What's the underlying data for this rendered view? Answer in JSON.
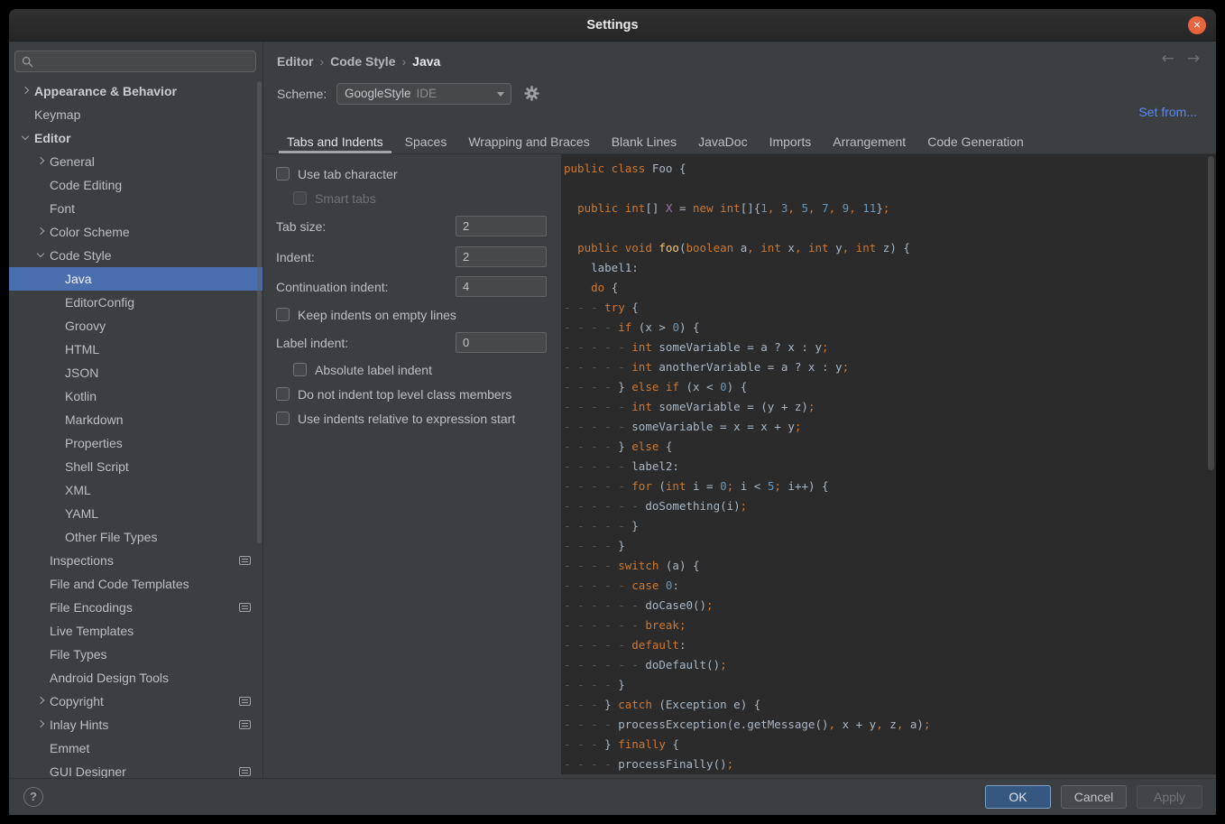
{
  "window": {
    "title": "Settings",
    "close_glyph": "×"
  },
  "sidebar": {
    "search": {
      "placeholder": ""
    },
    "items": [
      {
        "label": "Appearance & Behavior",
        "level": 0,
        "arrow": "collapsed",
        "bold": true
      },
      {
        "label": "Keymap",
        "level": 0
      },
      {
        "label": "Editor",
        "level": 0,
        "arrow": "expanded",
        "bold": true
      },
      {
        "label": "General",
        "level": 1,
        "arrow": "collapsed"
      },
      {
        "label": "Code Editing",
        "level": 1
      },
      {
        "label": "Font",
        "level": 1
      },
      {
        "label": "Color Scheme",
        "level": 1,
        "arrow": "collapsed"
      },
      {
        "label": "Code Style",
        "level": 1,
        "arrow": "expanded"
      },
      {
        "label": "Java",
        "level": 2,
        "selected": true
      },
      {
        "label": "EditorConfig",
        "level": 2
      },
      {
        "label": "Groovy",
        "level": 2
      },
      {
        "label": "HTML",
        "level": 2
      },
      {
        "label": "JSON",
        "level": 2
      },
      {
        "label": "Kotlin",
        "level": 2
      },
      {
        "label": "Markdown",
        "level": 2
      },
      {
        "label": "Properties",
        "level": 2
      },
      {
        "label": "Shell Script",
        "level": 2
      },
      {
        "label": "XML",
        "level": 2
      },
      {
        "label": "YAML",
        "level": 2
      },
      {
        "label": "Other File Types",
        "level": 2
      },
      {
        "label": "Inspections",
        "level": 1,
        "badge": true
      },
      {
        "label": "File and Code Templates",
        "level": 1
      },
      {
        "label": "File Encodings",
        "level": 1,
        "badge": true
      },
      {
        "label": "Live Templates",
        "level": 1
      },
      {
        "label": "File Types",
        "level": 1
      },
      {
        "label": "Android Design Tools",
        "level": 1
      },
      {
        "label": "Copyright",
        "level": 1,
        "arrow": "collapsed",
        "badge": true
      },
      {
        "label": "Inlay Hints",
        "level": 1,
        "arrow": "collapsed",
        "badge": true
      },
      {
        "label": "Emmet",
        "level": 1
      },
      {
        "label": "GUI Designer",
        "level": 1,
        "badge": true
      }
    ]
  },
  "header": {
    "breadcrumb": [
      "Editor",
      "Code Style",
      "Java"
    ],
    "separator": "›",
    "back_glyph": "←",
    "forward_glyph": "→",
    "scheme_label": "Scheme:",
    "scheme_value": "GoogleStyle",
    "scheme_suffix": "IDE",
    "set_from_link": "Set from..."
  },
  "tabs": {
    "selected_index": 0,
    "items": [
      "Tabs and Indents",
      "Spaces",
      "Wrapping and Braces",
      "Blank Lines",
      "JavaDoc",
      "Imports",
      "Arrangement",
      "Code Generation"
    ]
  },
  "form": {
    "use_tab_character": {
      "label": "Use tab character",
      "checked": false
    },
    "smart_tabs": {
      "label": "Smart tabs",
      "checked": false,
      "disabled": true
    },
    "tab_size": {
      "label": "Tab size:",
      "value": "2"
    },
    "indent": {
      "label": "Indent:",
      "value": "2"
    },
    "continuation_indent": {
      "label": "Continuation indent:",
      "value": "4"
    },
    "keep_indents_on_empty_lines": {
      "label": "Keep indents on empty lines",
      "checked": false
    },
    "label_indent": {
      "label": "Label indent:",
      "value": "0"
    },
    "absolute_label_indent": {
      "label": "Absolute label indent",
      "checked": false
    },
    "do_not_indent_top_level_class_members": {
      "label": "Do not indent top level class members",
      "checked": false
    },
    "use_indents_relative_to_expression_start": {
      "label": "Use indents relative to expression start",
      "checked": false
    }
  },
  "preview": {
    "lines": [
      [
        [
          "k",
          "public class "
        ],
        [
          "t",
          "Foo {"
        ]
      ],
      [],
      [
        [
          "t",
          "  "
        ],
        [
          "k",
          "public int"
        ],
        [
          "t",
          "[] "
        ],
        [
          "f",
          "X"
        ],
        [
          "t",
          " = "
        ],
        [
          "k",
          "new int"
        ],
        [
          "t",
          "[]{"
        ],
        [
          "n",
          "1"
        ],
        [
          "k",
          ", "
        ],
        [
          "n",
          "3"
        ],
        [
          "k",
          ", "
        ],
        [
          "n",
          "5"
        ],
        [
          "k",
          ", "
        ],
        [
          "n",
          "7"
        ],
        [
          "k",
          ", "
        ],
        [
          "n",
          "9"
        ],
        [
          "k",
          ", "
        ],
        [
          "n",
          "11"
        ],
        [
          "t",
          "}"
        ],
        [
          "k",
          ";"
        ]
      ],
      [],
      [
        [
          "t",
          "  "
        ],
        [
          "k",
          "public void "
        ],
        [
          "m",
          "foo"
        ],
        [
          "t",
          "("
        ],
        [
          "k",
          "boolean"
        ],
        [
          "t",
          " a"
        ],
        [
          "k",
          ", int"
        ],
        [
          "t",
          " x"
        ],
        [
          "k",
          ", int"
        ],
        [
          "t",
          " y"
        ],
        [
          "k",
          ", int"
        ],
        [
          "t",
          " z) {"
        ]
      ],
      [
        [
          "t",
          "    label1:"
        ]
      ],
      [
        [
          "t",
          "    "
        ],
        [
          "k",
          "do"
        ],
        [
          "t",
          " {"
        ]
      ],
      [
        [
          "w",
          "- - - "
        ],
        [
          "k",
          "try"
        ],
        [
          "t",
          " {"
        ]
      ],
      [
        [
          "w",
          "- - - - "
        ],
        [
          "k",
          "if"
        ],
        [
          "t",
          " (x > "
        ],
        [
          "n",
          "0"
        ],
        [
          "t",
          ") {"
        ]
      ],
      [
        [
          "w",
          "- - - - - "
        ],
        [
          "k",
          "int"
        ],
        [
          "t",
          " someVariable = a ? x : y"
        ],
        [
          "k",
          ";"
        ]
      ],
      [
        [
          "w",
          "- - - - - "
        ],
        [
          "k",
          "int"
        ],
        [
          "t",
          " anotherVariable = a ? x : y"
        ],
        [
          "k",
          ";"
        ]
      ],
      [
        [
          "w",
          "- - - - "
        ],
        [
          "t",
          "} "
        ],
        [
          "k",
          "else if"
        ],
        [
          "t",
          " (x < "
        ],
        [
          "n",
          "0"
        ],
        [
          "t",
          ") {"
        ]
      ],
      [
        [
          "w",
          "- - - - - "
        ],
        [
          "k",
          "int"
        ],
        [
          "t",
          " someVariable = (y + z)"
        ],
        [
          "k",
          ";"
        ]
      ],
      [
        [
          "w",
          "- - - - - "
        ],
        [
          "t",
          "someVariable = x = x + y"
        ],
        [
          "k",
          ";"
        ]
      ],
      [
        [
          "w",
          "- - - - "
        ],
        [
          "t",
          "} "
        ],
        [
          "k",
          "else"
        ],
        [
          "t",
          " {"
        ]
      ],
      [
        [
          "w",
          "- - - - - "
        ],
        [
          "t",
          "label2:"
        ]
      ],
      [
        [
          "w",
          "- - - - - "
        ],
        [
          "k",
          "for"
        ],
        [
          "t",
          " ("
        ],
        [
          "k",
          "int"
        ],
        [
          "t",
          " i = "
        ],
        [
          "n",
          "0"
        ],
        [
          "k",
          "; "
        ],
        [
          "t",
          "i < "
        ],
        [
          "n",
          "5"
        ],
        [
          "k",
          "; "
        ],
        [
          "t",
          "i++) {"
        ]
      ],
      [
        [
          "w",
          "- - - - - - "
        ],
        [
          "t",
          "doSomething(i)"
        ],
        [
          "k",
          ";"
        ]
      ],
      [
        [
          "w",
          "- - - - - "
        ],
        [
          "t",
          "}"
        ]
      ],
      [
        [
          "w",
          "- - - - "
        ],
        [
          "t",
          "}"
        ]
      ],
      [
        [
          "w",
          "- - - - "
        ],
        [
          "k",
          "switch"
        ],
        [
          "t",
          " (a) {"
        ]
      ],
      [
        [
          "w",
          "- - - - - "
        ],
        [
          "k",
          "case "
        ],
        [
          "n",
          "0"
        ],
        [
          "t",
          ":"
        ]
      ],
      [
        [
          "w",
          "- - - - - - "
        ],
        [
          "t",
          "doCase0()"
        ],
        [
          "k",
          ";"
        ]
      ],
      [
        [
          "w",
          "- - - - - - "
        ],
        [
          "k",
          "break;"
        ]
      ],
      [
        [
          "w",
          "- - - - - "
        ],
        [
          "k",
          "default"
        ],
        [
          "t",
          ":"
        ]
      ],
      [
        [
          "w",
          "- - - - - - "
        ],
        [
          "t",
          "doDefault()"
        ],
        [
          "k",
          ";"
        ]
      ],
      [
        [
          "w",
          "- - - - "
        ],
        [
          "t",
          "}"
        ]
      ],
      [
        [
          "w",
          "- - - "
        ],
        [
          "t",
          "} "
        ],
        [
          "k",
          "catch"
        ],
        [
          "t",
          " (Exception e) {"
        ]
      ],
      [
        [
          "w",
          "- - - - "
        ],
        [
          "t",
          "processException(e.getMessage()"
        ],
        [
          "k",
          ", "
        ],
        [
          "t",
          "x + y"
        ],
        [
          "k",
          ", "
        ],
        [
          "t",
          "z"
        ],
        [
          "k",
          ", "
        ],
        [
          "t",
          "a)"
        ],
        [
          "k",
          ";"
        ]
      ],
      [
        [
          "w",
          "- - - "
        ],
        [
          "t",
          "} "
        ],
        [
          "k",
          "finally"
        ],
        [
          "t",
          " {"
        ]
      ],
      [
        [
          "w",
          "- - - - "
        ],
        [
          "t",
          "processFinally()"
        ],
        [
          "k",
          ";"
        ]
      ]
    ]
  },
  "footer": {
    "help": "?",
    "ok": "OK",
    "cancel": "Cancel",
    "apply": "Apply",
    "apply_disabled": true
  },
  "colors": {
    "selection_blue": "#4b6eaf",
    "link_blue": "#548af7",
    "keyword_orange": "#cc7832",
    "number_blue": "#6897bb",
    "field_purple": "#9876aa",
    "method_yellow": "#ffc66d",
    "code_background": "#2b2b2b",
    "panel_background": "#3c3f41",
    "close_button_orange": "#e8643c",
    "ok_button_blue": "#365880"
  }
}
